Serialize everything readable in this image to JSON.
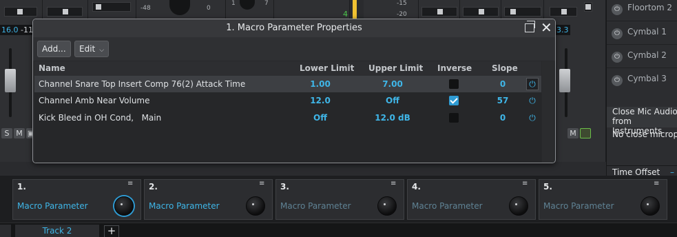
{
  "background": {
    "readouts": [
      "16.0",
      "-11",
      "3.3"
    ],
    "knob_marks": [
      "-48",
      "0",
      "1",
      "7",
      "-15",
      "-20",
      "4"
    ],
    "solo_label": "S",
    "mute_label": "M"
  },
  "instrument_panel": {
    "items": [
      {
        "label": "Floortom 2",
        "icon": "power-icon"
      },
      {
        "label": "Cymbal 1",
        "icon": "power-icon"
      },
      {
        "label": "Cymbal 2",
        "icon": "power-icon"
      },
      {
        "label": "Cymbal 3",
        "icon": "power-icon"
      }
    ],
    "section_title": "Close Mic Audio from Instruments",
    "section_text": "No close microph selected channel",
    "time_offset_label": "Time Offset",
    "time_offset_value": "–"
  },
  "dialog": {
    "title": "1. Macro Parameter Properties",
    "add_button": "Add...",
    "edit_button": "Edit",
    "columns": {
      "name": "Name",
      "lower": "Lower Limit",
      "upper": "Upper Limit",
      "inverse": "Inverse",
      "slope": "Slope"
    },
    "rows": [
      {
        "name": "Channel Snare Top Insert Comp 76(2) Attack Time",
        "lower": "1.00",
        "upper": "7.00",
        "inverse": false,
        "slope": "0",
        "selected": true
      },
      {
        "name": "Channel Amb Near Volume",
        "lower": "12.0",
        "upper": "Off",
        "inverse": true,
        "slope": "57",
        "selected": false
      },
      {
        "name": "Kick Bleed in OH Cond,   Main",
        "lower": "Off",
        "upper": "12.0 dB",
        "inverse": false,
        "slope": "0",
        "selected": false
      }
    ]
  },
  "macros": [
    {
      "number": "1.",
      "label": "Macro Parameter",
      "active": true
    },
    {
      "number": "2.",
      "label": "Macro Parameter",
      "active": true
    },
    {
      "number": "3.",
      "label": "Macro Parameter",
      "active": false
    },
    {
      "number": "4.",
      "label": "Macro Parameter",
      "active": false
    },
    {
      "number": "5.",
      "label": "Macro Parameter",
      "active": false
    }
  ],
  "tabs": {
    "active": "Track 2",
    "add": "+"
  },
  "colors": {
    "accent": "#3fb6e8",
    "dialog_bg": "#28292b",
    "selected_row": "#3d3f43"
  }
}
